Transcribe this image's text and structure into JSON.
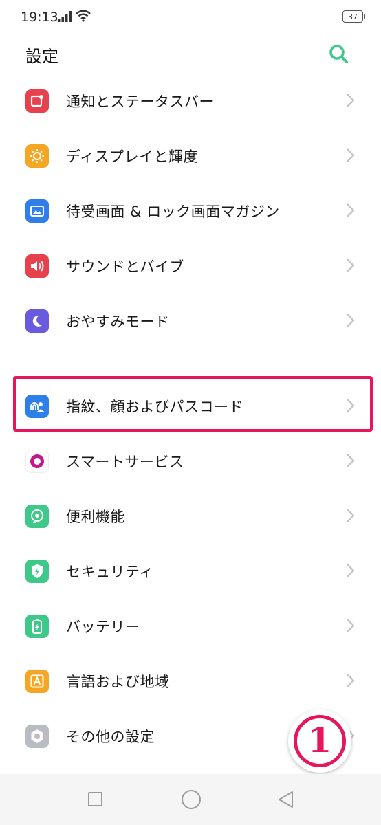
{
  "status_bar": {
    "time": "19:13",
    "battery": "37"
  },
  "header": {
    "title": "設定"
  },
  "groups": [
    [
      {
        "label": "通知とステータスバー",
        "icon": "notification-icon",
        "color": "#e8414e"
      },
      {
        "label": "ディスプレイと輝度",
        "icon": "brightness-icon",
        "color": "#f5a623"
      },
      {
        "label": "待受画面 & ロック画面マガジン",
        "icon": "wallpaper-icon",
        "color": "#2f7fe8"
      },
      {
        "label": "サウンドとバイブ",
        "icon": "sound-icon",
        "color": "#e8414e"
      },
      {
        "label": "おやすみモード",
        "icon": "moon-icon",
        "color": "#6a5ae0"
      }
    ],
    [
      {
        "label": "指紋、顔およびパスコード",
        "icon": "fingerprint-face-icon",
        "color": "#2f7fe8"
      },
      {
        "label": "スマートサービス",
        "icon": "smart-service-icon",
        "color": "#c4178a"
      },
      {
        "label": "便利機能",
        "icon": "convenience-icon",
        "color": "#3ec98b"
      },
      {
        "label": "セキュリティ",
        "icon": "shield-icon",
        "color": "#3ec98b"
      },
      {
        "label": "バッテリー",
        "icon": "battery-icon",
        "color": "#3ec98b"
      },
      {
        "label": "言語および地域",
        "icon": "language-icon",
        "color": "#f5a623"
      },
      {
        "label": "その他の設定",
        "icon": "more-settings-icon",
        "color": "#b9bcc2"
      }
    ]
  ],
  "annotation": {
    "step": "1",
    "accent": "#e5165d"
  }
}
